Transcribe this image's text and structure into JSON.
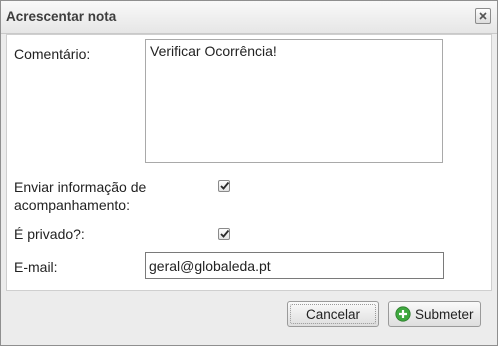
{
  "dialog": {
    "title": "Acrescentar nota",
    "close_icon": "close-icon"
  },
  "form": {
    "comment_label": "Comentário:",
    "comment_value": "Verificar Ocorrência!",
    "send_info_label": "Enviar informação de acompanhamento:",
    "send_info_checked": true,
    "private_label": "É privado?:",
    "private_checked": true,
    "email_label": "E-mail:",
    "email_value": "geral@globaleda.pt"
  },
  "buttons": {
    "cancel_label": "Cancelar",
    "submit_label": "Submeter",
    "submit_icon": "plus-circle-icon"
  },
  "colors": {
    "submit_icon_green": "#3fa83f"
  }
}
